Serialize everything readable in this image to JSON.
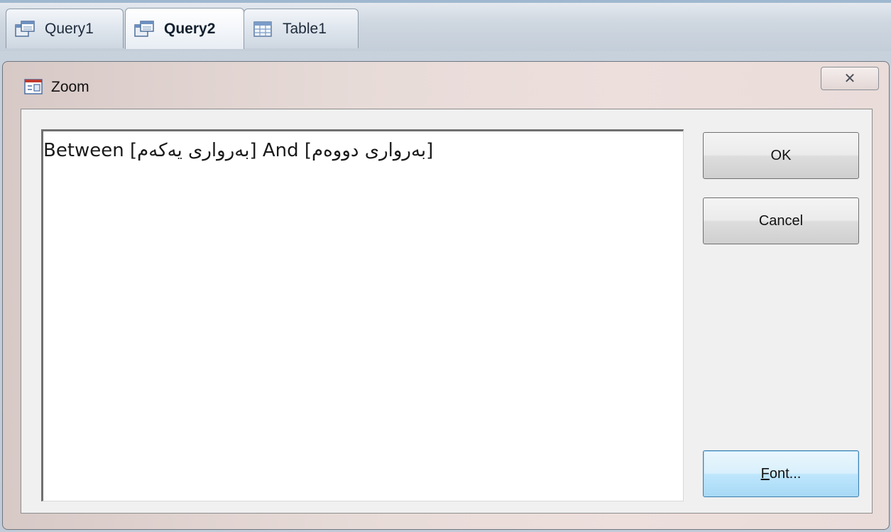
{
  "tabs": [
    {
      "label": "Query1",
      "icon": "query-icon",
      "active": false
    },
    {
      "label": "Query2",
      "icon": "query-icon",
      "active": true
    },
    {
      "label": "Table1",
      "icon": "table-icon",
      "active": false
    }
  ],
  "dialog": {
    "title": "Zoom",
    "close_glyph": "✕",
    "text_value": "Between [بەروارى يەكەم] And [بەروارى دووەم]",
    "buttons": {
      "ok": "OK",
      "cancel": "Cancel",
      "font_accel": "F",
      "font_rest": "ont..."
    }
  },
  "colors": {
    "tab_border": "#8e9aa8",
    "dialog_titlebar": "#e7dbd8",
    "focused_button": "#bee6fd"
  }
}
